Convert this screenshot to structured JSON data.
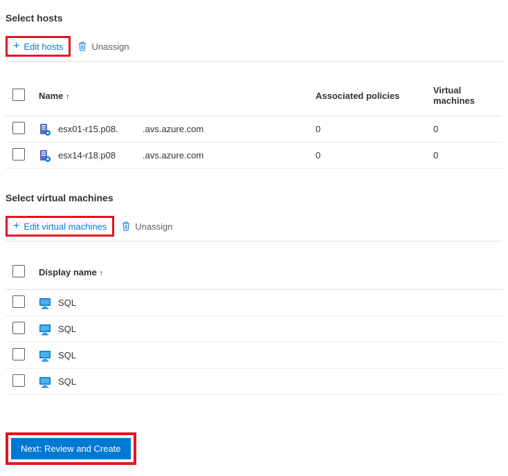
{
  "hosts_section": {
    "title": "Select hosts",
    "edit_label": "Edit hosts",
    "unassign_label": "Unassign",
    "columns": {
      "name": "Name",
      "policies": "Associated policies",
      "vms": "Virtual machines"
    },
    "rows": [
      {
        "name": "esx01-r15.p08.",
        "domain": ".avs.azure.com",
        "policies": "0",
        "vms": "0"
      },
      {
        "name": "esx14-r18.p08",
        "domain": ".avs.azure.com",
        "policies": "0",
        "vms": "0"
      }
    ]
  },
  "vms_section": {
    "title": "Select virtual machines",
    "edit_label": "Edit virtual machines",
    "unassign_label": "Unassign",
    "columns": {
      "display_name": "Display name"
    },
    "rows": [
      {
        "name": "SQL"
      },
      {
        "name": "SQL"
      },
      {
        "name": "SQL"
      },
      {
        "name": "SQL"
      }
    ]
  },
  "footer": {
    "next_label": "Next: Review and Create"
  }
}
